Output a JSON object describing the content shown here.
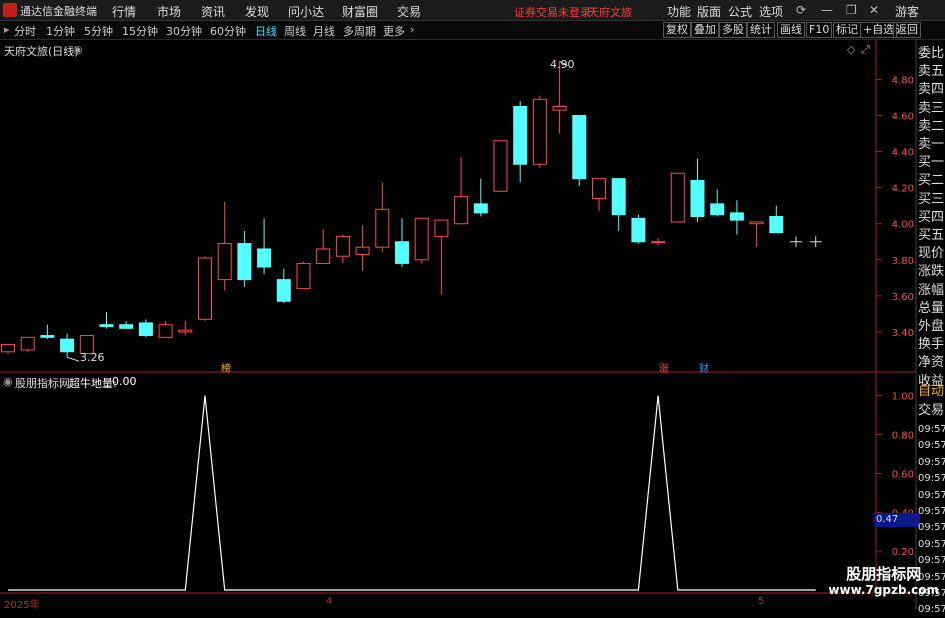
{
  "app": {
    "title": "通达信金融终端"
  },
  "menu": [
    "行情",
    "市场",
    "资讯",
    "发现",
    "问小达",
    "财富圈",
    "交易"
  ],
  "warning": "证券交易未登录",
  "stock_name": "天府文旅",
  "sys_buttons": [
    "功能",
    "版面",
    "公式",
    "选项"
  ],
  "guest": "游客",
  "periods": [
    "分时",
    "1分钟",
    "5分钟",
    "15分钟",
    "30分钟",
    "60分钟",
    "日线",
    "周线",
    "月线",
    "多周期",
    "更多"
  ],
  "active_period": "日线",
  "toolbar": [
    "复权",
    "叠加",
    "多股",
    "统计",
    "画线",
    "F10",
    "标记",
    "+自选",
    "返回"
  ],
  "chart_title": "天府文旅(日线)",
  "indicator": {
    "name": "股朋指标网",
    "label": "超牛地量:",
    "value": "0.00"
  },
  "side_labels": [
    "委比",
    "卖五",
    "卖四",
    "卖三",
    "卖二",
    "卖一",
    "买一",
    "买二",
    "买三",
    "买四",
    "买五",
    "现价",
    "涨跌",
    "涨幅",
    "总量",
    "外盘",
    "换手",
    "净资",
    "收益"
  ],
  "side_buttons": [
    "自动",
    "交易"
  ],
  "times": [
    "09:57",
    "09:57",
    "09:57",
    "09:57",
    "09:57",
    "09:57",
    "09:57",
    "09:57",
    "09:57",
    "09:57",
    "09:57",
    "09:57"
  ],
  "markers": [
    "榜",
    "涨",
    "财"
  ],
  "dates": [
    "2025年",
    "4",
    "5"
  ],
  "watermark": {
    "line1": "股朋指标网",
    "line2": "www.7gpzb.com"
  },
  "colors": {
    "up": "#ff4a4a",
    "down": "#54ffff",
    "axis": "#b01d1d",
    "active": "#3fe0ff"
  },
  "chart_data": {
    "type": "candlestick",
    "y_ticks": [
      "4.80",
      "4.60",
      "4.40",
      "4.20",
      "4.00",
      "3.80",
      "3.60",
      "3.40"
    ],
    "ylim": [
      3.2,
      4.93
    ],
    "high_label": "4.90",
    "low_label": "3.26",
    "candles": [
      {
        "o": 3.29,
        "h": 3.33,
        "l": 3.28,
        "c": 3.33
      },
      {
        "o": 3.3,
        "h": 3.37,
        "l": 3.29,
        "c": 3.37
      },
      {
        "o": 3.38,
        "h": 3.44,
        "l": 3.36,
        "c": 3.37
      },
      {
        "o": 3.36,
        "h": 3.39,
        "l": 3.26,
        "c": 3.29
      },
      {
        "o": 3.28,
        "h": 3.38,
        "l": 3.28,
        "c": 3.38
      },
      {
        "o": 3.44,
        "h": 3.51,
        "l": 3.42,
        "c": 3.43
      },
      {
        "o": 3.44,
        "h": 3.46,
        "l": 3.42,
        "c": 3.42
      },
      {
        "o": 3.45,
        "h": 3.47,
        "l": 3.37,
        "c": 3.38
      },
      {
        "o": 3.37,
        "h": 3.46,
        "l": 3.37,
        "c": 3.44
      },
      {
        "o": 3.4,
        "h": 3.46,
        "l": 3.38,
        "c": 3.41
      },
      {
        "o": 3.47,
        "h": 3.82,
        "l": 3.46,
        "c": 3.81
      },
      {
        "o": 3.69,
        "h": 4.12,
        "l": 3.63,
        "c": 3.89
      },
      {
        "o": 3.89,
        "h": 3.96,
        "l": 3.65,
        "c": 3.69
      },
      {
        "o": 3.86,
        "h": 4.03,
        "l": 3.72,
        "c": 3.76
      },
      {
        "o": 3.69,
        "h": 3.75,
        "l": 3.56,
        "c": 3.57
      },
      {
        "o": 3.64,
        "h": 3.79,
        "l": 3.64,
        "c": 3.78
      },
      {
        "o": 3.78,
        "h": 3.97,
        "l": 3.78,
        "c": 3.86
      },
      {
        "o": 3.82,
        "h": 3.94,
        "l": 3.78,
        "c": 3.93
      },
      {
        "o": 3.83,
        "h": 3.99,
        "l": 3.74,
        "c": 3.87
      },
      {
        "o": 3.87,
        "h": 4.23,
        "l": 3.84,
        "c": 4.08
      },
      {
        "o": 3.9,
        "h": 4.03,
        "l": 3.76,
        "c": 3.78
      },
      {
        "o": 3.8,
        "h": 4.01,
        "l": 3.78,
        "c": 4.03
      },
      {
        "o": 3.93,
        "h": 4.0,
        "l": 3.61,
        "c": 4.02
      },
      {
        "o": 4.0,
        "h": 4.37,
        "l": 4.0,
        "c": 4.15
      },
      {
        "o": 4.11,
        "h": 4.25,
        "l": 4.04,
        "c": 4.06
      },
      {
        "o": 4.18,
        "h": 4.43,
        "l": 4.18,
        "c": 4.46
      },
      {
        "o": 4.65,
        "h": 4.68,
        "l": 4.23,
        "c": 4.33
      },
      {
        "o": 4.33,
        "h": 4.71,
        "l": 4.31,
        "c": 4.69
      },
      {
        "o": 4.63,
        "h": 4.9,
        "l": 4.5,
        "c": 4.65
      },
      {
        "o": 4.6,
        "h": 4.6,
        "l": 4.21,
        "c": 4.25
      },
      {
        "o": 4.14,
        "h": 4.25,
        "l": 4.07,
        "c": 4.25
      },
      {
        "o": 4.25,
        "h": 4.25,
        "l": 3.96,
        "c": 4.05
      },
      {
        "o": 4.03,
        "h": 4.05,
        "l": 3.89,
        "c": 3.9
      },
      {
        "o": 3.9,
        "h": 3.92,
        "l": 3.88,
        "c": 3.9
      },
      {
        "o": 4.01,
        "h": 4.28,
        "l": 4.01,
        "c": 4.28
      },
      {
        "o": 4.24,
        "h": 4.36,
        "l": 4.01,
        "c": 4.04
      },
      {
        "o": 4.11,
        "h": 4.19,
        "l": 4.04,
        "c": 4.05
      },
      {
        "o": 4.06,
        "h": 4.13,
        "l": 3.94,
        "c": 4.02
      },
      {
        "o": 4.0,
        "h": 4.0,
        "l": 3.87,
        "c": 4.01
      },
      {
        "o": 4.04,
        "h": 4.1,
        "l": 3.97,
        "c": 3.95
      },
      {
        "o": 3.9,
        "h": 3.93,
        "l": 3.87,
        "c": 3.9
      },
      {
        "o": 3.9,
        "h": 3.93,
        "l": 3.87,
        "c": 3.9
      }
    ],
    "indicator": {
      "y_ticks": [
        "1.00",
        "0.80",
        "0.60",
        "0.40",
        "0.20"
      ],
      "ylim": [
        0,
        1.05
      ],
      "current": "0.47",
      "values": [
        0,
        0,
        0,
        0,
        0,
        0,
        0,
        0,
        0,
        0,
        1,
        0,
        0,
        0,
        0,
        0,
        0,
        0,
        0,
        0,
        0,
        0,
        0,
        0,
        0,
        0,
        0,
        0,
        0,
        0,
        0,
        0,
        0,
        1,
        0,
        0,
        0,
        0,
        0,
        0,
        0,
        0
      ]
    }
  }
}
